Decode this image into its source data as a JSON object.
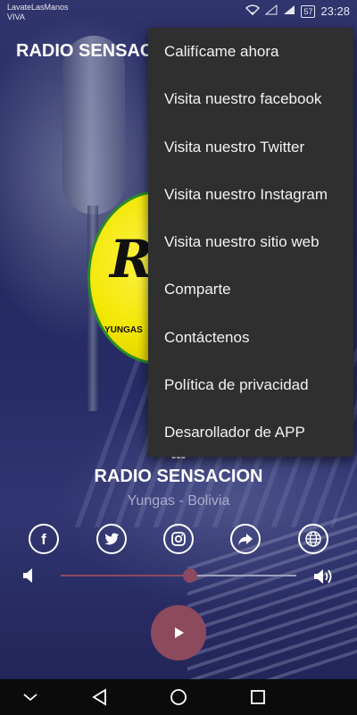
{
  "status_bar": {
    "carrier_line1": "LavateLasManos",
    "carrier_line2": "VIVA",
    "battery": "57",
    "time": "23:28"
  },
  "app_bar": {
    "title": "RADIO SENSACION"
  },
  "logo": {
    "text": "RS",
    "subtitle": "YUNGAS"
  },
  "now_playing": {
    "track": "---",
    "station": "RADIO SENSACION",
    "location": "Yungas - Bolivia"
  },
  "social_icons": [
    "facebook-icon",
    "twitter-icon",
    "instagram-icon",
    "share-icon",
    "globe-icon"
  ],
  "volume": {
    "level": 0.55
  },
  "menu": {
    "items": [
      "Califícame ahora",
      "Visita nuestro facebook",
      "Visita nuestro Twitter",
      "Visita nuestro Instagram",
      "Visita nuestro sitio web",
      "Comparte",
      "Contáctenos",
      "Política de privacidad",
      "Desarollador de APP"
    ]
  },
  "colors": {
    "accent": "#8d4a5d",
    "menu_bg": "#2f2f30",
    "location_text": "#a9abc9"
  }
}
